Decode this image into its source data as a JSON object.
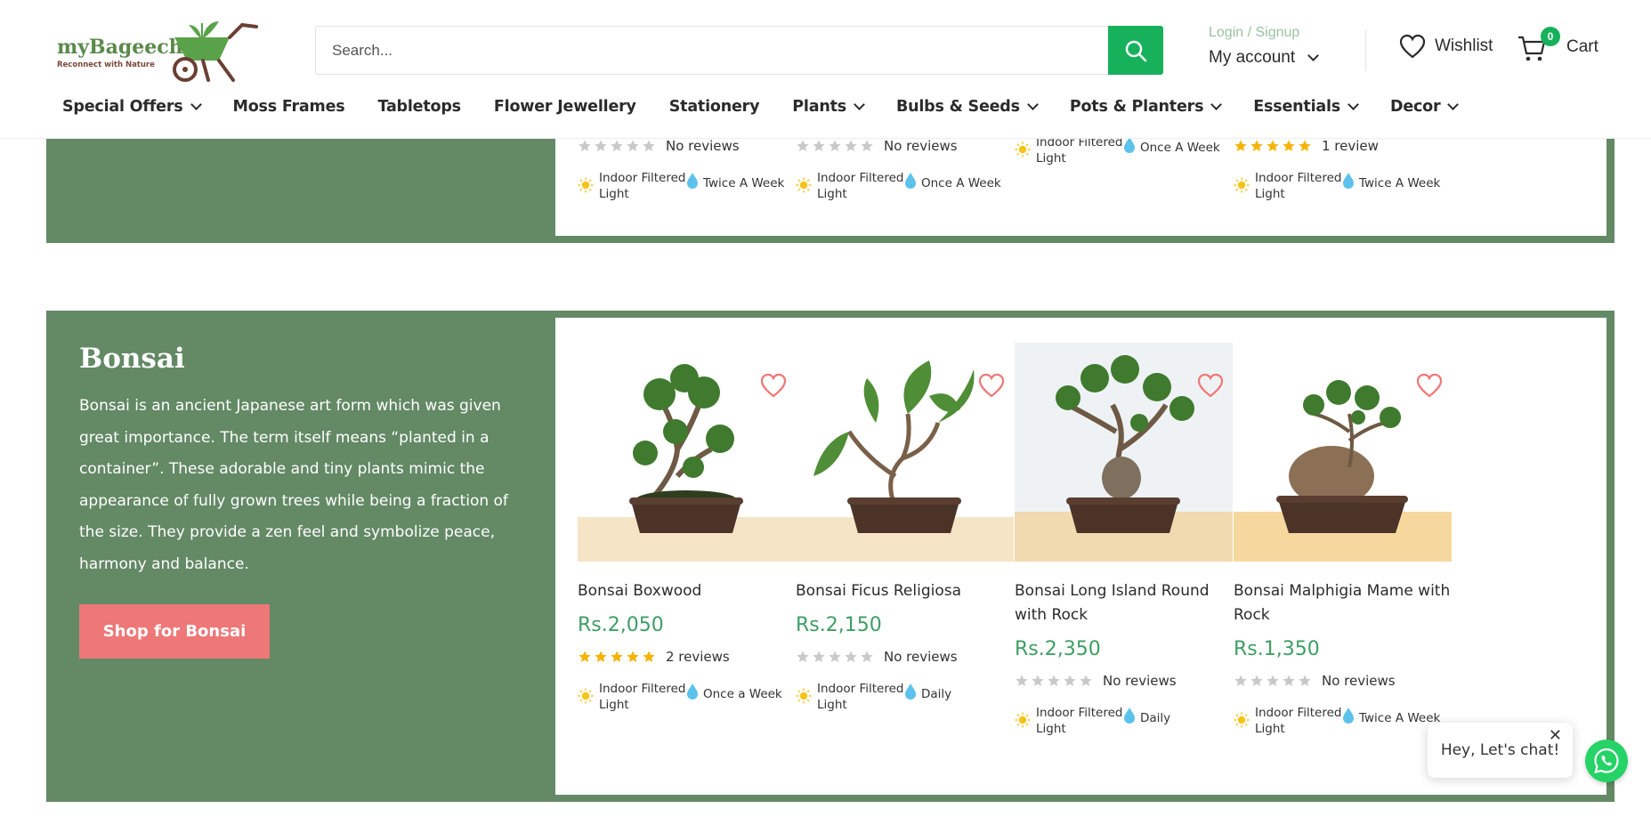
{
  "brand": {
    "name": "myBageecha",
    "tagline": "Reconnect with Nature",
    "colors": {
      "green": "#17b15c",
      "section": "#638965",
      "price": "#3e9e63",
      "button": "#ee7777"
    }
  },
  "search": {
    "placeholder": "Search..."
  },
  "account": {
    "login": "Login / Signup",
    "label": "My account"
  },
  "wishlist": {
    "label": "Wishlist"
  },
  "cart": {
    "label": "Cart",
    "count": "0"
  },
  "nav": [
    {
      "label": "Special Offers",
      "dropdown": true
    },
    {
      "label": "Moss Frames",
      "dropdown": false
    },
    {
      "label": "Tabletops",
      "dropdown": false
    },
    {
      "label": "Flower Jewellery",
      "dropdown": false
    },
    {
      "label": "Stationery",
      "dropdown": false
    },
    {
      "label": "Plants",
      "dropdown": true
    },
    {
      "label": "Bulbs & Seeds",
      "dropdown": true
    },
    {
      "label": "Pots & Planters",
      "dropdown": true
    },
    {
      "label": "Essentials",
      "dropdown": true
    },
    {
      "label": "Decor",
      "dropdown": true
    }
  ],
  "prev_section": {
    "cards": [
      {
        "rating": 0,
        "reviews": "No reviews",
        "light": "Indoor Filtered Light",
        "water": "Twice A Week"
      },
      {
        "rating": 0,
        "reviews": "No reviews",
        "light": "Indoor Filtered Light",
        "water": "Once A Week"
      },
      {
        "rating": null,
        "reviews": "",
        "light": "Indoor Filtered Light",
        "water": "Once A Week"
      },
      {
        "rating": 5,
        "reviews": "1 review",
        "light": "Indoor Filtered Light",
        "water": "Twice A Week"
      }
    ]
  },
  "bonsai": {
    "title": "Bonsai",
    "description": "Bonsai is an ancient Japanese art form which was given great importance. The term itself means “planted in a container”. These adorable and tiny plants mimic the appearance of fully grown trees while being a fraction of the size. They provide a zen feel and symbolize peace, harmony and balance.",
    "button": "Shop for Bonsai",
    "products": [
      {
        "name": "Bonsai Boxwood",
        "price": "Rs.2,050",
        "rating": 5,
        "reviews": "2 reviews",
        "light": "Indoor Filtered Light",
        "water": "Once a Week"
      },
      {
        "name": "Bonsai Ficus Religiosa",
        "price": "Rs.2,150",
        "rating": 0,
        "reviews": "No reviews",
        "light": "Indoor Filtered Light",
        "water": "Daily"
      },
      {
        "name": "Bonsai Long Island Round with Rock",
        "price": "Rs.2,350",
        "rating": 0,
        "reviews": "No reviews",
        "light": "Indoor Filtered Light",
        "water": "Daily"
      },
      {
        "name": "Bonsai Malphigia Mame with Rock",
        "price": "Rs.1,350",
        "rating": 0,
        "reviews": "No reviews",
        "light": "Indoor Filtered Light",
        "water": "Twice A Week"
      }
    ]
  },
  "chat": {
    "text": "Hey, Let's chat!"
  }
}
